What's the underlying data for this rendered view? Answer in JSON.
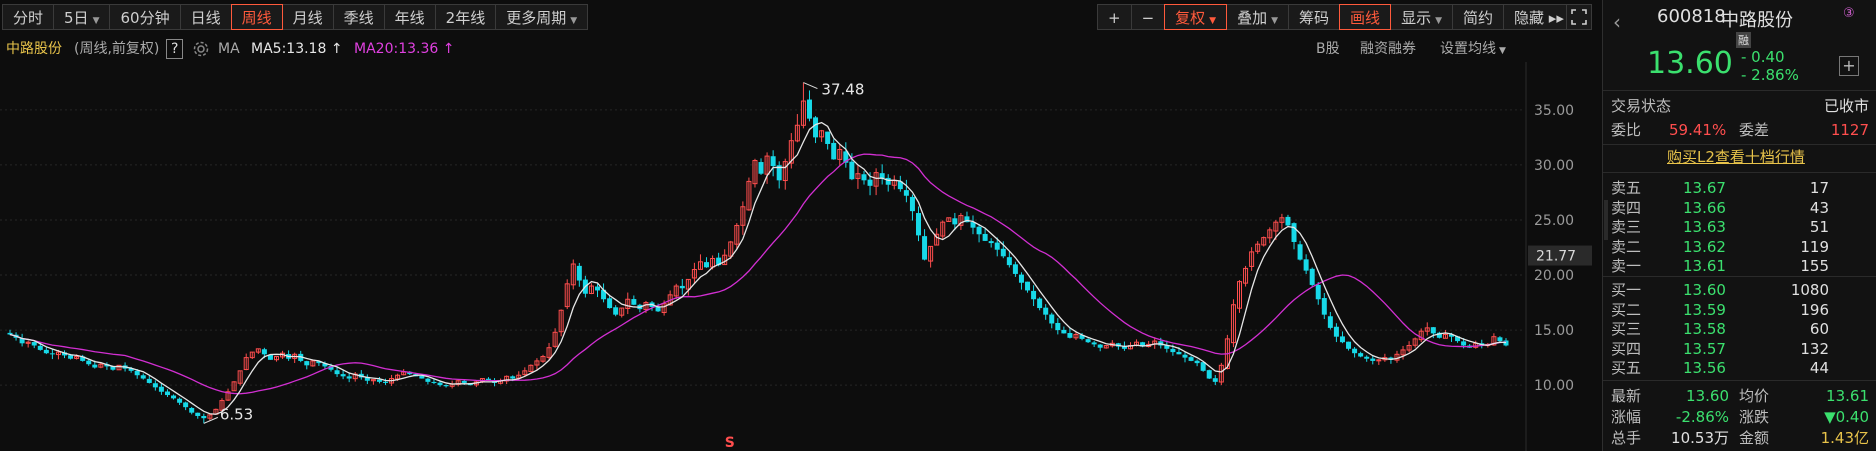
{
  "toolbar_left": [
    {
      "label": "分时",
      "caret": false,
      "active": false
    },
    {
      "label": "5日",
      "caret": true,
      "active": false
    },
    {
      "label": "60分钟",
      "caret": false,
      "active": false
    },
    {
      "label": "日线",
      "caret": false,
      "active": false
    },
    {
      "label": "周线",
      "caret": false,
      "active": true
    },
    {
      "label": "月线",
      "caret": false,
      "active": false
    },
    {
      "label": "季线",
      "caret": false,
      "active": false
    },
    {
      "label": "年线",
      "caret": false,
      "active": false
    },
    {
      "label": "2年线",
      "caret": false,
      "active": false
    },
    {
      "label": "更多周期",
      "caret": true,
      "active": false
    }
  ],
  "toolbar_right": [
    {
      "label": "+",
      "caret": false,
      "active": false
    },
    {
      "label": "−",
      "caret": false,
      "active": false
    },
    {
      "label": "复权",
      "caret": true,
      "active": true
    },
    {
      "label": "叠加",
      "caret": true,
      "active": false
    },
    {
      "label": "筹码",
      "caret": false,
      "active": false
    },
    {
      "label": "画线",
      "caret": false,
      "active": true
    },
    {
      "label": "显示",
      "caret": true,
      "active": false
    },
    {
      "label": "简约",
      "caret": false,
      "active": false
    },
    {
      "label": "隐藏 ▸▸",
      "caret": false,
      "active": false
    }
  ],
  "info": {
    "stock_name": "中路股份",
    "period": "(周线,前复权)",
    "help": "?",
    "ma_label": "MA",
    "ma5": "MA5:13.18",
    "ma20": "MA20:13.36",
    "arrow": "↑",
    "b_share": "B股",
    "margin": "融资融券",
    "set_ma": "设置均线"
  },
  "colors": {
    "up": "#ff4e4e",
    "down": "#17d9e8",
    "ma5": "#e6e6e6",
    "ma20": "#d22fd2",
    "grid": "#262626"
  },
  "chart_data": {
    "type": "candlestick",
    "y_ticks": [
      "35.00",
      "30.00",
      "25.00",
      "20.00",
      "15.00",
      "10.00"
    ],
    "y_tick_values": [
      35,
      30,
      25,
      20,
      15,
      10
    ],
    "current_price_label": "21.77",
    "current_price_value": 21.77,
    "high_label": "37.48",
    "high_value": 37.48,
    "low_label": "6.53",
    "low_value": 6.53,
    "marker": "S",
    "ylim": [
      5.2,
      38.8
    ],
    "closes": [
      14.6,
      14.3,
      13.8,
      13.9,
      13.6,
      13.2,
      12.9,
      12.8,
      13.0,
      12.7,
      12.4,
      12.6,
      12.2,
      11.9,
      11.6,
      11.9,
      11.7,
      11.4,
      11.8,
      11.5,
      11.3,
      10.9,
      10.6,
      10.2,
      9.8,
      9.4,
      9.1,
      8.8,
      8.4,
      8.0,
      7.5,
      7.2,
      7.0,
      7.3,
      7.8,
      8.6,
      9.4,
      10.3,
      11.3,
      12.5,
      13.0,
      13.3,
      12.8,
      12.3,
      12.6,
      12.9,
      12.4,
      12.8,
      12.2,
      11.8,
      12.2,
      12.0,
      11.7,
      11.4,
      11.0,
      10.8,
      10.6,
      11.0,
      10.7,
      10.4,
      10.5,
      10.3,
      10.2,
      10.6,
      10.9,
      11.2,
      11.0,
      10.8,
      10.6,
      10.3,
      10.2,
      10.0,
      9.9,
      10.1,
      10.4,
      10.2,
      10.0,
      10.3,
      10.6,
      10.4,
      10.2,
      10.4,
      10.8,
      10.6,
      10.9,
      11.3,
      11.8,
      12.2,
      12.6,
      13.4,
      14.8,
      16.8,
      19.2,
      21.0,
      19.5,
      18.3,
      19.0,
      18.6,
      17.8,
      17.0,
      16.4,
      17.0,
      17.8,
      17.3,
      16.9,
      17.5,
      17.1,
      16.7,
      17.4,
      18.2,
      19.0,
      18.8,
      19.6,
      20.5,
      21.2,
      20.7,
      21.5,
      20.9,
      21.8,
      23.0,
      24.5,
      26.2,
      28.5,
      30.4,
      29.2,
      30.8,
      29.9,
      28.6,
      30.3,
      32.2,
      33.6,
      35.8,
      34.2,
      32.5,
      33.1,
      31.9,
      30.5,
      31.4,
      30.2,
      28.7,
      29.2,
      28.6,
      28.1,
      29.3,
      28.8,
      28.2,
      28.6,
      27.8,
      27.2,
      25.8,
      23.6,
      21.4,
      22.6,
      23.7,
      24.8,
      25.2,
      24.6,
      25.4,
      24.8,
      24.3,
      23.7,
      23.1,
      22.9,
      22.3,
      21.7,
      20.9,
      20.1,
      19.3,
      18.6,
      17.8,
      17.0,
      16.4,
      15.6,
      15.0,
      14.7,
      14.3,
      14.6,
      14.2,
      13.9,
      13.7,
      13.4,
      13.6,
      13.8,
      13.5,
      13.3,
      13.6,
      13.9,
      13.5,
      13.7,
      14.0,
      13.6,
      13.3,
      13.0,
      12.8,
      12.5,
      12.2,
      12.0,
      11.3,
      10.6,
      10.3,
      11.8,
      14.2,
      17.3,
      19.4,
      20.6,
      22.1,
      22.8,
      23.4,
      24.1,
      24.8,
      25.2,
      24.5,
      23.0,
      21.4,
      20.4,
      19.1,
      17.8,
      16.4,
      15.2,
      14.4,
      13.9,
      13.3,
      12.9,
      12.6,
      12.4,
      12.2,
      12.3,
      12.5,
      12.3,
      12.8,
      13.2,
      13.6,
      14.2,
      14.9,
      15.2,
      14.7,
      14.3,
      14.6,
      14.4,
      14.0,
      13.6,
      13.4,
      13.8,
      13.6,
      13.7,
      14.4,
      14.0,
      13.6
    ]
  },
  "side": {
    "code": "600818",
    "name": "中路股份",
    "badge": "③",
    "rong": "融",
    "price": "13.60",
    "change": "- 0.40",
    "change_pct": "- 2.86%",
    "plus": "+",
    "trade_status_label": "交易状态",
    "trade_status_value": "已收市",
    "weibi_label": "委比",
    "weibi_value": "59.41%",
    "weicha_label": "委差",
    "weicha_value": "1127",
    "l2_link": "购买L2查看十档行情",
    "asks": [
      {
        "label": "卖五",
        "price": "13.67",
        "vol": "17"
      },
      {
        "label": "卖四",
        "price": "13.66",
        "vol": "43"
      },
      {
        "label": "卖三",
        "price": "13.63",
        "vol": "51"
      },
      {
        "label": "卖二",
        "price": "13.62",
        "vol": "119"
      },
      {
        "label": "卖一",
        "price": "13.61",
        "vol": "155"
      }
    ],
    "bids": [
      {
        "label": "买一",
        "price": "13.60",
        "vol": "1080"
      },
      {
        "label": "买二",
        "price": "13.59",
        "vol": "196"
      },
      {
        "label": "买三",
        "price": "13.58",
        "vol": "60"
      },
      {
        "label": "买四",
        "price": "13.57",
        "vol": "132"
      },
      {
        "label": "买五",
        "price": "13.56",
        "vol": "44"
      }
    ],
    "stats": [
      {
        "l1": "最新",
        "v1": "13.60",
        "l2": "均价",
        "v2": "13.61"
      },
      {
        "l1": "涨幅",
        "v1": "-2.86%",
        "l2": "涨跌",
        "v2": "▼0.40"
      },
      {
        "l1": "总手",
        "v1": "10.53万",
        "l2": "金额",
        "v2": "1.43亿"
      }
    ]
  }
}
